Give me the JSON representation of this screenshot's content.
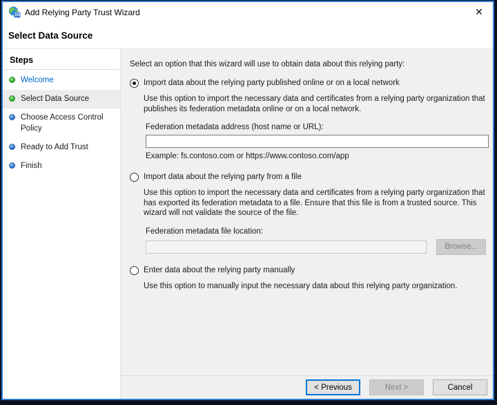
{
  "window": {
    "title": "Add Relying Party Trust Wizard",
    "close_glyph": "✕",
    "app_icon": "relying-party-trust-globe-icon"
  },
  "header": {
    "title": "Select Data Source"
  },
  "sidebar": {
    "title": "Steps",
    "items": [
      {
        "label": "Welcome",
        "state": "done",
        "current": false,
        "link": true
      },
      {
        "label": "Select Data Source",
        "state": "done",
        "current": true,
        "link": false
      },
      {
        "label": "Choose Access Control Policy",
        "state": "todo",
        "current": false,
        "link": false
      },
      {
        "label": "Ready to Add Trust",
        "state": "todo",
        "current": false,
        "link": false
      },
      {
        "label": "Finish",
        "state": "todo",
        "current": false,
        "link": false
      }
    ]
  },
  "main": {
    "intro": "Select an option that this wizard will use to obtain data about this relying party:",
    "options": [
      {
        "label": "Import data about the relying party published online or on a local network",
        "selected": true,
        "description": "Use this option to import the necessary data and certificates from a relying party organization that publishes its federation metadata online or on a local network.",
        "field_label": "Federation metadata address (host name or URL):",
        "field_value": "",
        "example": "Example: fs.contoso.com or https://www.contoso.com/app"
      },
      {
        "label": "Import data about the relying party from a file",
        "selected": false,
        "description": "Use this option to import the necessary data and certificates from a relying party organization that has exported its federation metadata to a file. Ensure that this file is from a trusted source.  This wizard will not validate the source of the file.",
        "field_label": "Federation metadata file location:",
        "field_value": "",
        "browse_label": "Browse..."
      },
      {
        "label": "Enter data about the relying party manually",
        "selected": false,
        "description": "Use this option to manually input the necessary data about this relying party organization."
      }
    ]
  },
  "footer": {
    "previous_label": "< Previous",
    "next_label": "Next >",
    "cancel_label": "Cancel"
  },
  "colors": {
    "window_border": "#2b7cd3",
    "focus_blue": "#0078d7",
    "step_done_green": "#33b833",
    "step_todo_blue": "#2e7bd6",
    "link_blue": "#0066cc",
    "panel_gray": "#f0f0f0"
  }
}
